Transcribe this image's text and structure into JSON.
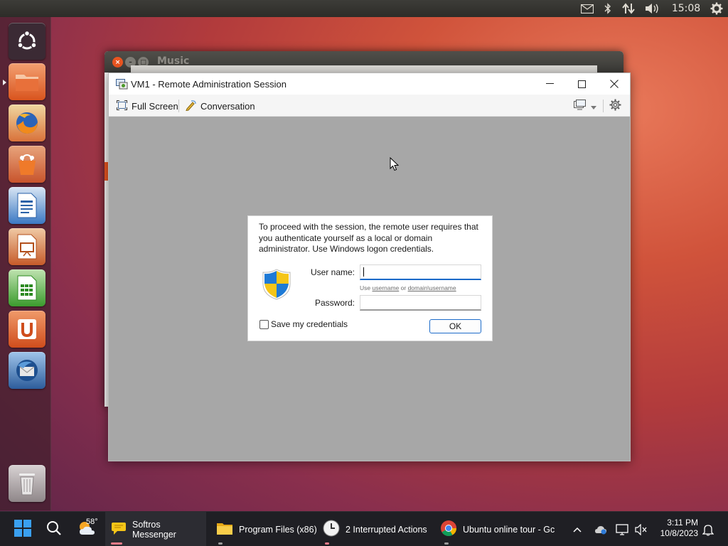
{
  "top_panel": {
    "clock": "15:08",
    "indicators": [
      "mail-icon",
      "bluetooth-icon",
      "network-icon",
      "volume-icon",
      "gear-icon"
    ]
  },
  "launcher": {
    "items": [
      "ubuntu-dash",
      "files",
      "firefox",
      "software-center",
      "writer",
      "impress",
      "calc",
      "ubuntu-one",
      "thunderbird",
      "trash"
    ]
  },
  "background_window": {
    "title": "Music"
  },
  "remote_window": {
    "title": "VM1 - Remote Administration Session",
    "toolbar": {
      "full_screen_label": "Full Screen",
      "conversation_label": "Conversation"
    }
  },
  "credentials_dialog": {
    "message": "To proceed with the session, the remote user requires that you authenticate yourself as a local or domain administrator. Use Windows logon credentials.",
    "username_label": "User name:",
    "username_value": "",
    "hint_prefix": "Use ",
    "hint_link1": "username",
    "hint_mid": " or ",
    "hint_link2": "domain\\username",
    "password_label": "Password:",
    "password_value": "",
    "save_credentials_label": "Save my credentials",
    "save_credentials_checked": false,
    "ok_label": "OK"
  },
  "taskbar": {
    "weather_temp": "58°",
    "apps": [
      {
        "label": "Softros Messenger",
        "active": true
      },
      {
        "label": "Program Files (x86)",
        "active": false
      },
      {
        "label": "2 Interrupted Actions",
        "active": false
      },
      {
        "label": "Ubuntu online tour - Gc",
        "active": false
      }
    ],
    "time": "3:11 PM",
    "date": "10/8/2023"
  },
  "colors": {
    "accent_blue": "#1b6ac9",
    "taskbar_bg": "#1f1f24",
    "remote_area_bg": "#a7a7a7"
  }
}
